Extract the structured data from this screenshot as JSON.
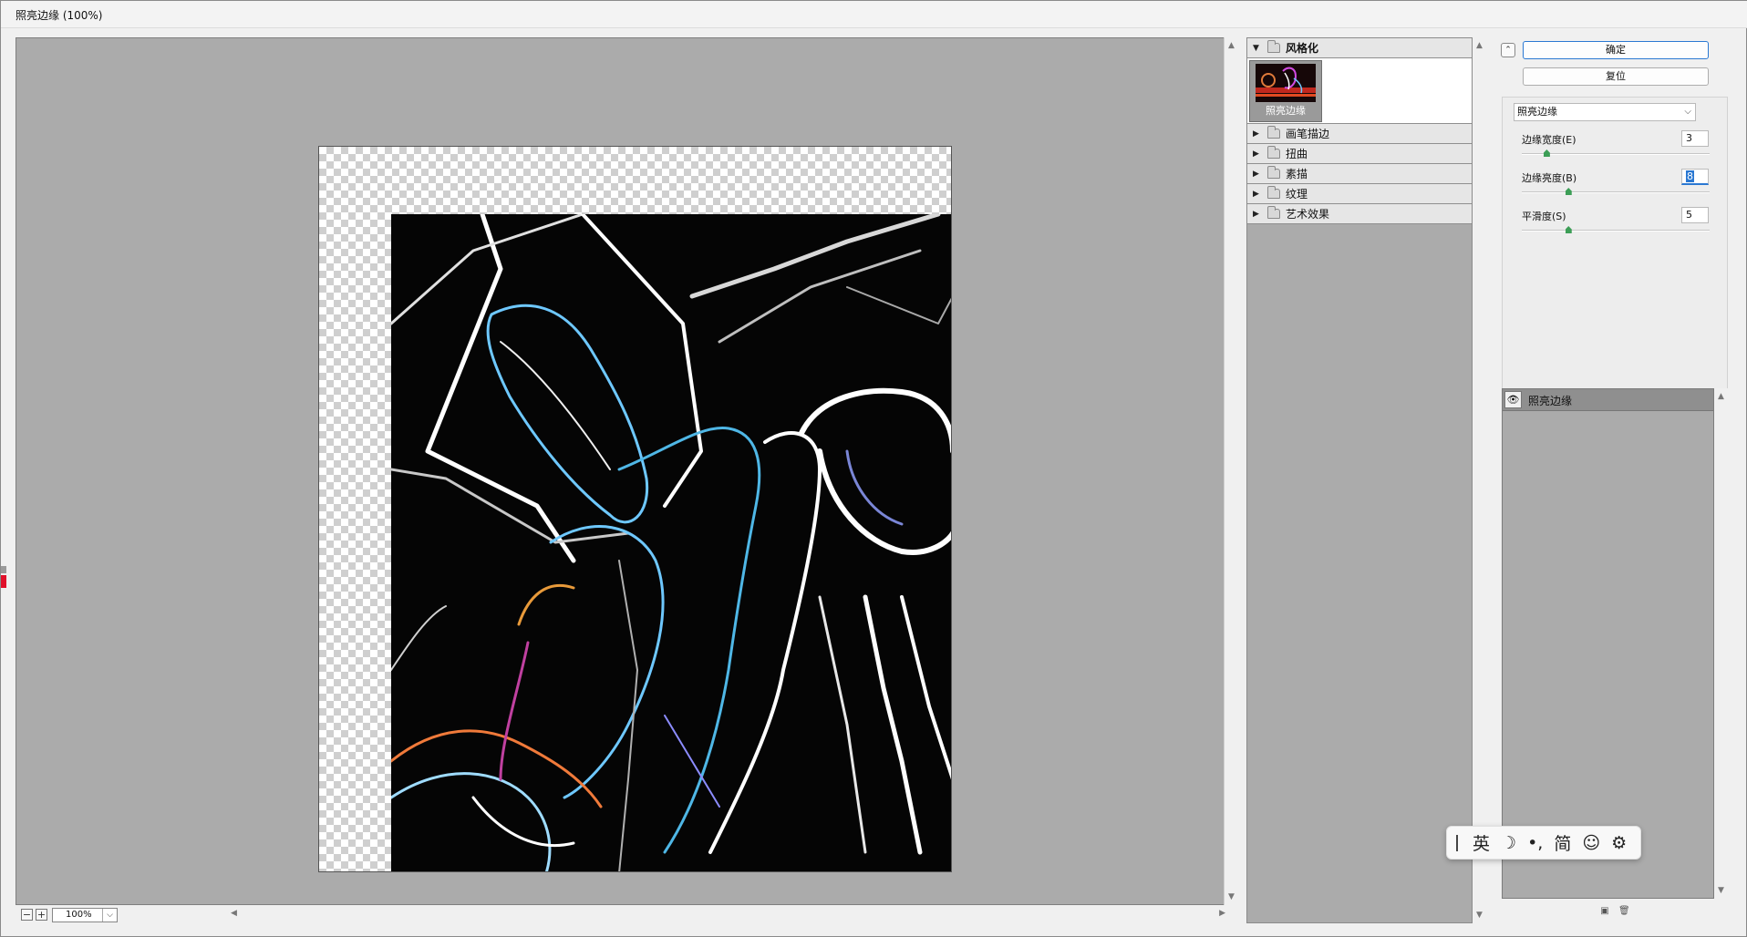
{
  "window": {
    "title": "照亮边缘 (100%)"
  },
  "preview": {
    "zoom": "100%",
    "zoom_out_symbol": "−",
    "zoom_in_symbol": "+"
  },
  "gallery": {
    "open_category": "风格化",
    "thumbnail_caption": "照亮边缘",
    "categories": [
      "画笔描边",
      "扭曲",
      "素描",
      "纹理",
      "艺术效果"
    ]
  },
  "settings": {
    "ok_label": "确定",
    "reset_label": "复位",
    "filter_selected": "照亮边缘",
    "params": [
      {
        "label": "边缘宽度(E)",
        "value": "3",
        "fraction": 0.12
      },
      {
        "label": "边缘亮度(B)",
        "value": "8",
        "fraction": 0.24
      },
      {
        "label": "平滑度(S)",
        "value": "5",
        "fraction": 0.24
      }
    ]
  },
  "layers": {
    "items": [
      {
        "name": "照亮边缘"
      }
    ]
  },
  "ime": {
    "items": [
      "英",
      "☽",
      "•,",
      "简",
      "☺",
      "⚙"
    ]
  }
}
